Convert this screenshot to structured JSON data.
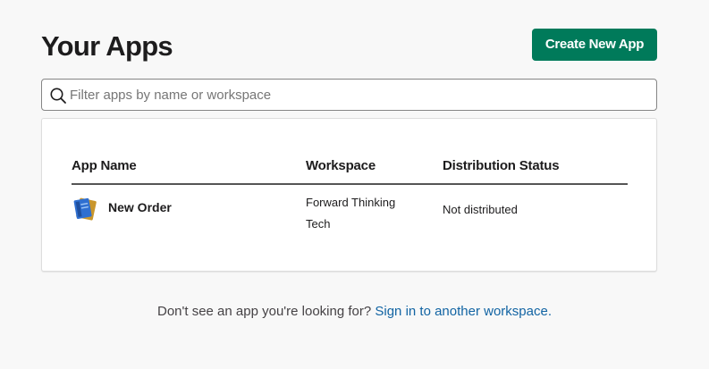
{
  "header": {
    "title": "Your Apps",
    "create_button_label": "Create New App"
  },
  "search": {
    "placeholder": "Filter apps by name or workspace",
    "value": "",
    "icon": "search-icon"
  },
  "apps_table": {
    "columns": [
      "App Name",
      "Workspace",
      "Distribution Status"
    ],
    "rows": [
      {
        "icon": "notebook-icon",
        "name": "New Order",
        "workspace": "Forward Thinking Tech",
        "status": "Not distributed"
      }
    ]
  },
  "footer": {
    "prompt": "Don't see an app you're looking for?",
    "link_label": "Sign in to another workspace",
    "suffix": "."
  },
  "colors": {
    "primary_button": "#007a5a",
    "link": "#1264a3",
    "background": "#f8f8f8"
  }
}
